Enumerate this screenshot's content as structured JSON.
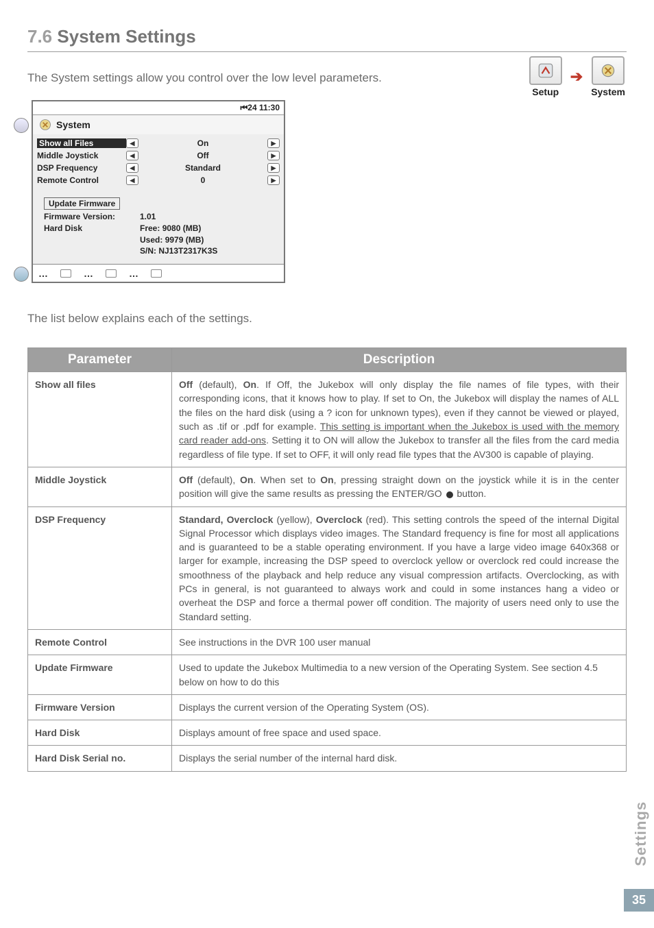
{
  "page": {
    "section_number": "7.6",
    "section_title": "System Settings",
    "intro_text": "The System settings allow you control over the low level parameters.",
    "explain_text": "The list below explains each of the settings.",
    "side_label": "Settings",
    "page_number": "35"
  },
  "nav": {
    "setup_label": "Setup",
    "system_label": "System"
  },
  "device": {
    "status_time": "24  11:30",
    "status_prefix": "⏮",
    "title": "System",
    "rows": [
      {
        "label": "Show all Files",
        "value": "On",
        "highlight": true
      },
      {
        "label": "Middle Joystick",
        "value": "Off",
        "highlight": false
      },
      {
        "label": "DSP Frequency",
        "value": "Standard",
        "highlight": false
      },
      {
        "label": "Remote Control",
        "value": "0",
        "highlight": false
      }
    ],
    "update_box": "Update Firmware",
    "firmware_label": "Firmware Version:",
    "firmware_value": "1.01",
    "harddisk_label": "Hard Disk",
    "hd_free_label": "Free:",
    "hd_free_value": "9080 (MB)",
    "hd_used_label": "Used:",
    "hd_used_value": "9979 (MB)",
    "hd_sn_label": "S/N:",
    "hd_sn_value": "NJ13T2317K3S"
  },
  "table": {
    "header_parameter": "Parameter",
    "header_description": "Description",
    "rows": [
      {
        "param": "Show all files",
        "desc_bold1": "Off",
        "desc_mid1": " (default), ",
        "desc_bold2": "On",
        "desc_rest1": ". If Off, the Jukebox will only display the file names of file types, with their corresponding icons, that it knows how to play. If set to On, the Jukebox will display the names of ALL the files on the hard disk (using a ? icon for unknown types), even if they cannot be viewed or played, such as .tif or .pdf for example. ",
        "desc_ul": "This setting is important when the Jukebox is used with the memory card reader add-ons",
        "desc_rest2": ". Setting it to ON will allow the Jukebox to transfer all the files from the card media regardless of file type. If set to OFF, it will only read file types that the AV300 is capable of playing."
      },
      {
        "param": "Middle Joystick",
        "desc_bold1": "Off",
        "desc_mid1": " (default), ",
        "desc_bold2": "On",
        "desc_mid2": ". When set to ",
        "desc_bold3": "On",
        "desc_rest1": ", pressing straight down on the joystick while it is in the center position will give the same results as pressing the ENTER/GO ",
        "desc_rest2": " button."
      },
      {
        "param": "DSP Frequency",
        "desc_bold1": "Standard, Overclock",
        "desc_mid1": " (yellow), ",
        "desc_bold2": "Overclock",
        "desc_rest1": " (red). This setting controls the speed of the internal Digital Signal Processor which displays video images. The Standard frequency is fine for most all applications and is guaranteed to be a stable operating environment. If you have a large video image 640x368 or larger for example, increasing the DSP speed to overclock yellow or overclock red could increase the smoothness of the playback and help reduce any visual compression artifacts. Overclocking, as with PCs in general, is not guaranteed to always work and could in some instances hang a video or overheat the DSP and force a thermal power off condition. The majority of users need only to use the Standard setting."
      },
      {
        "param": "Remote Control",
        "desc_plain": "See instructions in the DVR 100 user manual"
      },
      {
        "param": "Update Firmware",
        "desc_plain": "Used to update the Jukebox Multimedia to a new version of the Operating System. See section 4.5 below on how to do this"
      },
      {
        "param": "Firmware Version",
        "desc_plain": "Displays the current version of the Operating System (OS)."
      },
      {
        "param": "Hard Disk",
        "desc_plain": "Displays amount of free space and used space."
      },
      {
        "param": "Hard Disk Serial no.",
        "desc_plain": "Displays the serial number of the internal hard disk."
      }
    ]
  }
}
